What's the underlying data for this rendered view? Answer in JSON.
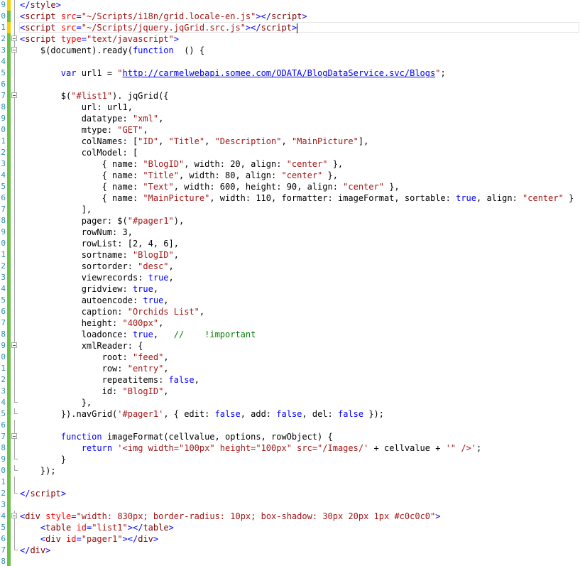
{
  "editor": {
    "language": "html-razor",
    "colors": {
      "tag": "#800000",
      "bracket": "#0000ff",
      "attribute": "#ff0000",
      "string": "#a31515",
      "keyword": "#0000ff",
      "comment": "#008000",
      "line_number": "#2b91af",
      "change_saved": "#6cc04a",
      "change_unsaved": "#f2d400"
    },
    "lines": [
      {
        "n": "9",
        "chg": "unsaved",
        "fold": "rail",
        "segs": [
          [
            "br",
            "</"
          ],
          [
            "tg",
            "style"
          ],
          [
            "br",
            ">"
          ]
        ]
      },
      {
        "n": "0",
        "chg": "saved",
        "fold": "rail",
        "segs": [
          [
            "br",
            "<"
          ],
          [
            "tg",
            "script"
          ],
          [
            "at",
            " src"
          ],
          [
            "br",
            "="
          ],
          [
            "st",
            "\"~/Scripts/i18n/grid.locale-en.js\""
          ],
          [
            "br",
            ">"
          ],
          [
            "br",
            "</"
          ],
          [
            "tg",
            "script"
          ],
          [
            "br",
            ">"
          ]
        ]
      },
      {
        "n": "1",
        "chg": "unsaved",
        "fold": "rail",
        "caret": true,
        "segs": [
          [
            "br",
            "<"
          ],
          [
            "tg",
            "script"
          ],
          [
            "at",
            " src"
          ],
          [
            "br",
            "="
          ],
          [
            "st",
            "\"~/Scripts/jquery.jqGrid.src.js\""
          ],
          [
            "br",
            ">"
          ],
          [
            "br",
            "</"
          ],
          [
            "tg",
            "script"
          ],
          [
            "br",
            ">"
          ]
        ]
      },
      {
        "n": "2",
        "chg": "saved",
        "fold": "box",
        "segs": [
          [
            "br",
            "<"
          ],
          [
            "tg",
            "script"
          ],
          [
            "at",
            " type"
          ],
          [
            "br",
            "="
          ],
          [
            "st",
            "\"text/javascript\""
          ],
          [
            "br",
            ">"
          ]
        ]
      },
      {
        "n": "3",
        "chg": "saved",
        "fold": "box",
        "segs": [
          [
            "",
            "    $(document).ready("
          ],
          [
            "kw",
            "function"
          ],
          [
            "",
            "  () {"
          ]
        ]
      },
      {
        "n": "4",
        "chg": "saved",
        "fold": "rail",
        "segs": []
      },
      {
        "n": "5",
        "chg": "saved",
        "fold": "rail",
        "segs": [
          [
            "",
            "        "
          ],
          [
            "kw",
            "var"
          ],
          [
            "",
            " url1 = "
          ],
          [
            "st",
            "\""
          ],
          [
            "url",
            "http://carmelwebapi.somee.com/ODATA/BlogDataService.svc/Blogs"
          ],
          [
            "st",
            "\""
          ],
          [
            "",
            ";"
          ]
        ]
      },
      {
        "n": "6",
        "chg": "saved",
        "fold": "rail",
        "segs": []
      },
      {
        "n": "7",
        "chg": "saved",
        "fold": "box",
        "segs": [
          [
            "",
            "        $("
          ],
          [
            "st",
            "\"#list1\""
          ],
          [
            "",
            "). jqGrid({"
          ]
        ]
      },
      {
        "n": "8",
        "chg": "saved",
        "fold": "rail",
        "segs": [
          [
            "",
            "            url: url1,"
          ]
        ]
      },
      {
        "n": "9",
        "chg": "saved",
        "fold": "rail",
        "segs": [
          [
            "",
            "            datatype: "
          ],
          [
            "st",
            "\"xml\""
          ],
          [
            "",
            ","
          ]
        ]
      },
      {
        "n": "0",
        "chg": "saved",
        "fold": "rail",
        "segs": [
          [
            "",
            "            mtype: "
          ],
          [
            "st",
            "\"GET\""
          ],
          [
            "",
            ","
          ]
        ]
      },
      {
        "n": "1",
        "chg": "saved",
        "fold": "rail",
        "segs": [
          [
            "",
            "            colNames: ["
          ],
          [
            "st",
            "\"ID\""
          ],
          [
            "",
            ", "
          ],
          [
            "st",
            "\"Title\""
          ],
          [
            "",
            ", "
          ],
          [
            "st",
            "\"Description\""
          ],
          [
            "",
            ", "
          ],
          [
            "st",
            "\"MainPicture\""
          ],
          [
            "",
            "],"
          ]
        ]
      },
      {
        "n": "2",
        "chg": "saved",
        "fold": "rail",
        "segs": [
          [
            "",
            "            colModel: ["
          ]
        ]
      },
      {
        "n": "3",
        "chg": "saved",
        "fold": "rail",
        "segs": [
          [
            "",
            "                { name: "
          ],
          [
            "st",
            "\"BlogID\""
          ],
          [
            "",
            ", width: 20, align: "
          ],
          [
            "st",
            "\"center\""
          ],
          [
            "",
            " },"
          ]
        ]
      },
      {
        "n": "4",
        "chg": "saved",
        "fold": "rail",
        "segs": [
          [
            "",
            "                { name: "
          ],
          [
            "st",
            "\"Title\""
          ],
          [
            "",
            ", width: 80, align: "
          ],
          [
            "st",
            "\"center\""
          ],
          [
            "",
            " },"
          ]
        ]
      },
      {
        "n": "5",
        "chg": "saved",
        "fold": "rail",
        "segs": [
          [
            "",
            "                { name: "
          ],
          [
            "st",
            "\"Text\""
          ],
          [
            "",
            ", width: 600, height: 90, align: "
          ],
          [
            "st",
            "\"center\""
          ],
          [
            "",
            " },"
          ]
        ]
      },
      {
        "n": "6",
        "chg": "saved",
        "fold": "rail",
        "segs": [
          [
            "",
            "                { name: "
          ],
          [
            "st",
            "\"MainPicture\""
          ],
          [
            "",
            ", width: 110, formatter: imageFormat, sortable: "
          ],
          [
            "kw",
            "true"
          ],
          [
            "",
            ", align: "
          ],
          [
            "st",
            "\"center\""
          ],
          [
            "",
            " }"
          ]
        ]
      },
      {
        "n": "7",
        "chg": "saved",
        "fold": "rail",
        "segs": [
          [
            "",
            "            ],"
          ]
        ]
      },
      {
        "n": "8",
        "chg": "saved",
        "fold": "rail",
        "segs": [
          [
            "",
            "            pager: $("
          ],
          [
            "st",
            "\"#pager1\""
          ],
          [
            "",
            "),"
          ]
        ]
      },
      {
        "n": "9",
        "chg": "saved",
        "fold": "rail",
        "segs": [
          [
            "",
            "            rowNum: 3,"
          ]
        ]
      },
      {
        "n": "0",
        "chg": "saved",
        "fold": "rail",
        "segs": [
          [
            "",
            "            rowList: [2, 4, 6],"
          ]
        ]
      },
      {
        "n": "1",
        "chg": "saved",
        "fold": "rail",
        "segs": [
          [
            "",
            "            sortname: "
          ],
          [
            "st",
            "\"BlogID\""
          ],
          [
            "",
            ","
          ]
        ]
      },
      {
        "n": "2",
        "chg": "saved",
        "fold": "rail",
        "segs": [
          [
            "",
            "            sortorder: "
          ],
          [
            "st",
            "\"desc\""
          ],
          [
            "",
            ","
          ]
        ]
      },
      {
        "n": "3",
        "chg": "saved",
        "fold": "rail",
        "segs": [
          [
            "",
            "            viewrecords: "
          ],
          [
            "kw",
            "true"
          ],
          [
            "",
            ","
          ]
        ]
      },
      {
        "n": "4",
        "chg": "saved",
        "fold": "rail",
        "segs": [
          [
            "",
            "            gridview: "
          ],
          [
            "kw",
            "true"
          ],
          [
            "",
            ","
          ]
        ]
      },
      {
        "n": "5",
        "chg": "saved",
        "fold": "rail",
        "segs": [
          [
            "",
            "            autoencode: "
          ],
          [
            "kw",
            "true"
          ],
          [
            "",
            ","
          ]
        ]
      },
      {
        "n": "6",
        "chg": "saved",
        "fold": "rail",
        "segs": [
          [
            "",
            "            caption: "
          ],
          [
            "st",
            "\"Orchids List\""
          ],
          [
            "",
            ","
          ]
        ]
      },
      {
        "n": "7",
        "chg": "saved",
        "fold": "rail",
        "segs": [
          [
            "",
            "            height: "
          ],
          [
            "st",
            "\"400px\""
          ],
          [
            "",
            ","
          ]
        ]
      },
      {
        "n": "8",
        "chg": "saved",
        "fold": "rail",
        "segs": [
          [
            "",
            "            loadonce: "
          ],
          [
            "kw",
            "true"
          ],
          [
            "",
            ",   "
          ],
          [
            "cm",
            "//    !important"
          ]
        ]
      },
      {
        "n": "9",
        "chg": "saved",
        "fold": "box",
        "segs": [
          [
            "",
            "            xmlReader: {"
          ]
        ]
      },
      {
        "n": "0",
        "chg": "saved",
        "fold": "rail",
        "segs": [
          [
            "",
            "                root: "
          ],
          [
            "st",
            "\"feed\""
          ],
          [
            "",
            ","
          ]
        ]
      },
      {
        "n": "1",
        "chg": "saved",
        "fold": "rail",
        "segs": [
          [
            "",
            "                row: "
          ],
          [
            "st",
            "\"entry\""
          ],
          [
            "",
            ","
          ]
        ]
      },
      {
        "n": "2",
        "chg": "saved",
        "fold": "rail",
        "segs": [
          [
            "",
            "                repeatitems: "
          ],
          [
            "kw",
            "false"
          ],
          [
            "",
            ","
          ]
        ]
      },
      {
        "n": "3",
        "chg": "saved",
        "fold": "rail",
        "segs": [
          [
            "",
            "                id: "
          ],
          [
            "st",
            "\"BlogID\""
          ],
          [
            "",
            ","
          ]
        ]
      },
      {
        "n": "4",
        "chg": "saved",
        "fold": "end",
        "segs": [
          [
            "",
            "            },"
          ]
        ]
      },
      {
        "n": "5",
        "chg": "saved",
        "fold": "end",
        "segs": [
          [
            "",
            "        }).navGrid("
          ],
          [
            "st",
            "'#pager1'"
          ],
          [
            "",
            ", { edit: "
          ],
          [
            "kw",
            "false"
          ],
          [
            "",
            ", add: "
          ],
          [
            "kw",
            "false"
          ],
          [
            "",
            ", del: "
          ],
          [
            "kw",
            "false"
          ],
          [
            "",
            " });"
          ]
        ]
      },
      {
        "n": "6",
        "chg": "saved",
        "fold": "rail",
        "segs": []
      },
      {
        "n": "7",
        "chg": "saved",
        "fold": "box",
        "segs": [
          [
            "",
            "        "
          ],
          [
            "kw",
            "function"
          ],
          [
            "",
            " imageFormat(cellvalue, options, rowObject) {"
          ]
        ]
      },
      {
        "n": "8",
        "chg": "saved",
        "fold": "rail",
        "segs": [
          [
            "",
            "            "
          ],
          [
            "kw",
            "return"
          ],
          [
            "",
            " "
          ],
          [
            "st",
            "'<img width=\"100px\" height=\"100px\" src=\"/Images/'"
          ],
          [
            "",
            " + cellvalue + "
          ],
          [
            "st",
            "'\" />'"
          ],
          [
            "",
            ";"
          ]
        ]
      },
      {
        "n": "9",
        "chg": "saved",
        "fold": "end",
        "segs": [
          [
            "",
            "        }"
          ]
        ]
      },
      {
        "n": "0",
        "chg": "saved",
        "fold": "end",
        "segs": [
          [
            "",
            "    });"
          ]
        ]
      },
      {
        "n": "1",
        "chg": "saved",
        "fold": "rail",
        "segs": []
      },
      {
        "n": "2",
        "chg": "saved",
        "fold": "end",
        "segs": [
          [
            "br",
            "</"
          ],
          [
            "tg",
            "script"
          ],
          [
            "br",
            ">"
          ]
        ]
      },
      {
        "n": "3",
        "chg": "saved",
        "fold": "none",
        "segs": []
      },
      {
        "n": "4",
        "chg": "saved",
        "fold": "box",
        "segs": [
          [
            "br",
            "<"
          ],
          [
            "tg",
            "div"
          ],
          [
            "at",
            " style"
          ],
          [
            "br",
            "="
          ],
          [
            "st",
            "\"width: 830px; border-radius: 10px; box-shadow: 30px 20px 1px #c0c0c0\""
          ],
          [
            "br",
            ">"
          ]
        ]
      },
      {
        "n": "5",
        "chg": "saved",
        "fold": "rail",
        "segs": [
          [
            "",
            "    "
          ],
          [
            "br",
            "<"
          ],
          [
            "tg",
            "table"
          ],
          [
            "at",
            " id"
          ],
          [
            "br",
            "="
          ],
          [
            "st",
            "\"list1\""
          ],
          [
            "br",
            "></"
          ],
          [
            "tg",
            "table"
          ],
          [
            "br",
            ">"
          ]
        ]
      },
      {
        "n": "6",
        "chg": "saved",
        "fold": "rail",
        "segs": [
          [
            "",
            "    "
          ],
          [
            "br",
            "<"
          ],
          [
            "tg",
            "div"
          ],
          [
            "at",
            " id"
          ],
          [
            "br",
            "="
          ],
          [
            "st",
            "\"pager1\""
          ],
          [
            "br",
            "></"
          ],
          [
            "tg",
            "div"
          ],
          [
            "br",
            ">"
          ]
        ]
      },
      {
        "n": "7",
        "chg": "saved",
        "fold": "end",
        "segs": [
          [
            "br",
            "</"
          ],
          [
            "tg",
            "div"
          ],
          [
            "br",
            ">"
          ]
        ]
      },
      {
        "n": "8",
        "chg": "saved",
        "fold": "none",
        "segs": []
      }
    ]
  }
}
